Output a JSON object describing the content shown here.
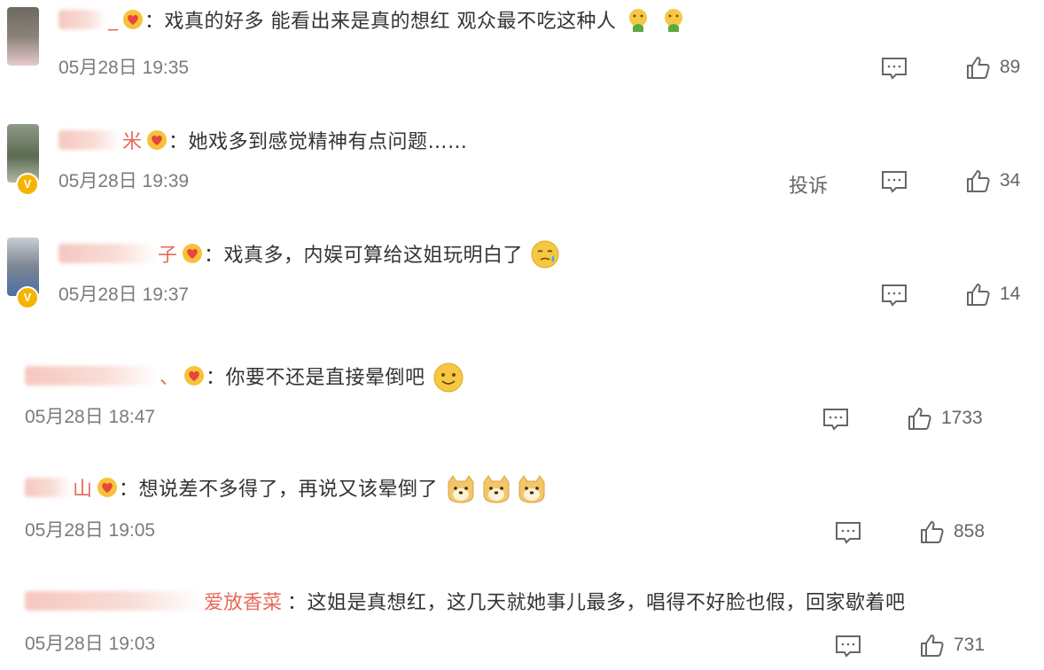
{
  "comments": [
    {
      "name_tail": "_",
      "text": "：戏真的好多 能看出来是真的想红 观众最不吃这种人",
      "emojis": [
        "sick-emoji",
        "sick-emoji"
      ],
      "time": "05月28日 19:35",
      "likes": "89",
      "report": "",
      "verified": false
    },
    {
      "name_tail": "米",
      "text": "：她戏多到感觉精神有点问题……",
      "emojis": [],
      "time": "05月28日 19:39",
      "likes": "34",
      "report": "投诉",
      "verified": true
    },
    {
      "name_tail": "子",
      "text": "：戏真多，内娱可算给这姐玩明白了",
      "emojis": [
        "sweat-emoji"
      ],
      "time": "05月28日 19:37",
      "likes": "14",
      "report": "",
      "verified": true
    },
    {
      "name_tail": "、",
      "text": "：你要不还是直接晕倒吧",
      "emojis": [
        "smile-emoji"
      ],
      "time": "05月28日 18:47",
      "likes": "1733",
      "report": "",
      "verified": false
    },
    {
      "name_tail": "山",
      "text": "：想说差不多得了，再说又该晕倒了",
      "emojis": [
        "doge-emoji",
        "doge-emoji",
        "doge-emoji"
      ],
      "time": "05月28日 19:05",
      "likes": "858",
      "report": "",
      "verified": false
    },
    {
      "name_tail": "爱放香菜",
      "text": "：这姐是真想红，这几天就她事儿最多，唱得不好脸也假，回家歇着吧",
      "emojis": [],
      "time": "05月28日 19:03",
      "likes": "731",
      "report": "",
      "verified": false
    }
  ],
  "colors": {
    "name_accent": "#e86a5a",
    "badge_red": "#e8453c",
    "badge_gold": "#f5b400",
    "text_main": "#333333",
    "text_meta": "#7b7b7b"
  }
}
